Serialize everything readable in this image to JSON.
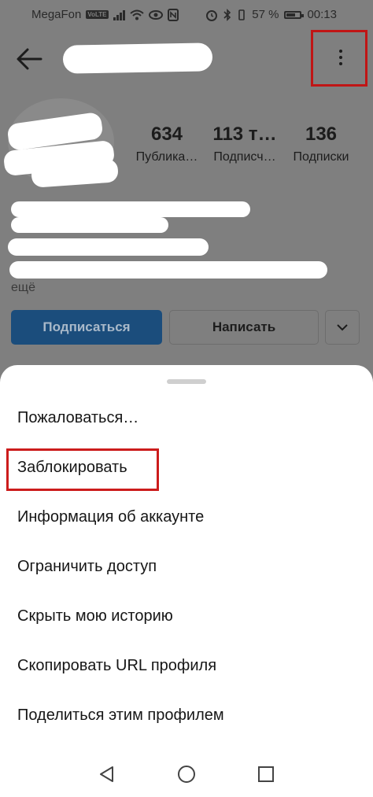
{
  "status_bar": {
    "carrier": "MegaFon",
    "volte": "VoLTE",
    "battery_percent": "57 %",
    "time": "00:13"
  },
  "header": {
    "back_icon": "arrow-left-icon",
    "more_icon": "more-vertical-icon"
  },
  "profile": {
    "stats": [
      {
        "value": "634",
        "label": "Публика…"
      },
      {
        "value": "113 т…",
        "label": "Подписч…"
      },
      {
        "value": "136",
        "label": "Подписки"
      }
    ],
    "more_label": "ещё",
    "subscribe_label": "Подписаться",
    "message_label": "Написать",
    "suggest_icon": "chevron-down-icon"
  },
  "sheet": {
    "items": [
      {
        "label": "Пожаловаться…"
      },
      {
        "label": "Заблокировать"
      },
      {
        "label": "Информация об аккаунте"
      },
      {
        "label": "Ограничить доступ"
      },
      {
        "label": "Скрыть мою историю"
      },
      {
        "label": "Скопировать URL профиля"
      },
      {
        "label": "Поделиться этим профилем"
      }
    ]
  },
  "navbar": {
    "back_icon": "triangle-back-icon",
    "home_icon": "circle-home-icon",
    "recents_icon": "square-recents-icon"
  },
  "colors": {
    "accent_box": "#cc1c1c",
    "subscribe_button": "#1b4d7c"
  }
}
